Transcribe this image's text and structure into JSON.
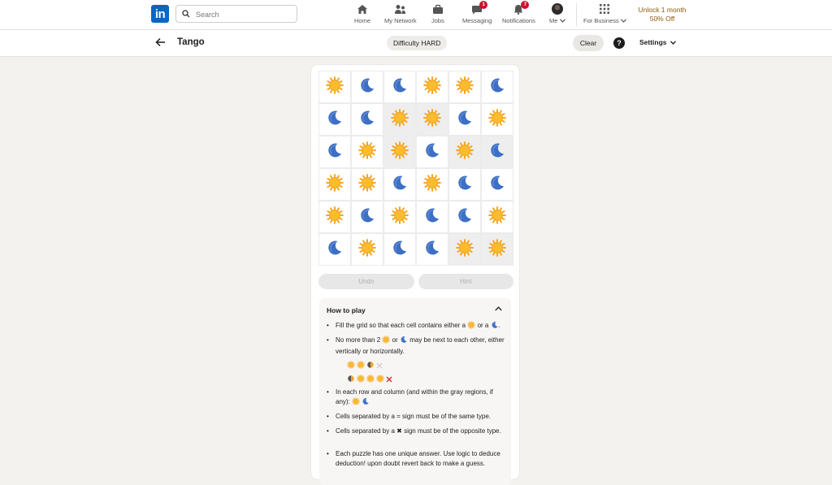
{
  "nav": {
    "logo": "in",
    "search_placeholder": "Search",
    "items": [
      {
        "label": "Home",
        "icon": "home-icon"
      },
      {
        "label": "My Network",
        "icon": "network-icon"
      },
      {
        "label": "Jobs",
        "icon": "briefcase-icon"
      },
      {
        "label": "Messaging",
        "icon": "chat-icon",
        "badge": "1"
      },
      {
        "label": "Notifications",
        "icon": "bell-icon",
        "badge": "7"
      },
      {
        "label": "Me",
        "icon": "avatar"
      },
      {
        "label": "For Business",
        "icon": "grid-icon"
      }
    ],
    "promo_line1": "Unlock 1 month",
    "promo_line2": "50% Off"
  },
  "game": {
    "title": "Tango",
    "difficulty": "Difficulty HARD",
    "clear_label": "Clear",
    "help_label": "?",
    "settings_label": "Settings",
    "grid": [
      [
        "sun",
        "moon",
        "moon",
        "sun",
        "sun",
        "moon"
      ],
      [
        "moon",
        "moon",
        "sun",
        "sun",
        "moon",
        "sun"
      ],
      [
        "moon",
        "sun",
        "sun",
        "moon",
        "sun",
        "moon"
      ],
      [
        "sun",
        "sun",
        "moon",
        "sun",
        "moon",
        "moon"
      ],
      [
        "sun",
        "moon",
        "sun",
        "moon",
        "moon",
        "sun"
      ],
      [
        "moon",
        "sun",
        "moon",
        "moon",
        "sun",
        "sun"
      ]
    ],
    "locked": [
      [
        1,
        2
      ],
      [
        1,
        3
      ],
      [
        2,
        2
      ],
      [
        2,
        4
      ],
      [
        2,
        5
      ],
      [
        5,
        4
      ],
      [
        5,
        5
      ]
    ],
    "undo_label": "Undo",
    "hint_label": "Hint"
  },
  "how_to_play": {
    "title": "How to play",
    "rule1_a": "Fill the grid so that each cell contains either a",
    "rule1_or": "or a",
    "rule2_a": "No more than 2",
    "rule2_or": "or",
    "rule2_b": "may be next to each other, either vertically or horizontally.",
    "rule3": "In each row and column (and within the gray regions, if any):",
    "rule4": "Cells separated by a = sign must be of the same type.",
    "rule5": "Cells separated by a ✖ sign must be of the opposite type.",
    "rule6": "Each puzzle has one unique answer. Use logic to deduce deduction! upon doubt revert back to make a guess."
  },
  "colors": {
    "brand": "#0a66c2",
    "sun": "#f5a623",
    "moon": "#3d6fc4",
    "badge": "#cb112d",
    "promo": "#915907"
  }
}
